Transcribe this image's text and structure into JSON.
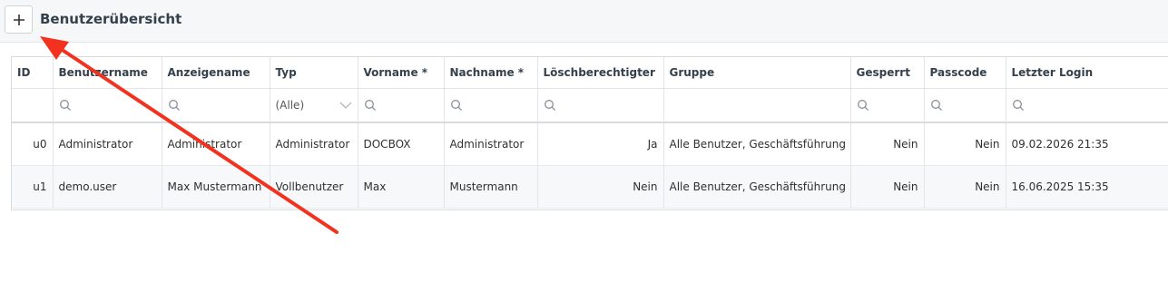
{
  "header": {
    "title": "Benutzerübersicht",
    "add_icon": "plus-icon"
  },
  "table": {
    "columns": [
      "ID",
      "Benutzername",
      "Anzeigename",
      "Typ",
      "Vorname *",
      "Nachname *",
      "Löschberechtigter",
      "Gruppe",
      "Gesperrt",
      "Passcode",
      "Letzter Login"
    ],
    "type_filter": {
      "selected": "(Alle)"
    },
    "rows": [
      {
        "id": "u0",
        "username": "Administrator",
        "display_name": "Administrator",
        "type": "Administrator",
        "first_name": "DOCBOX",
        "last_name": "Administrator",
        "deleter": "Ja",
        "group": "Alle Benutzer, Geschäftsführung",
        "locked": "Nein",
        "passcode": "Nein",
        "last_login": "09.02.2026 21:35"
      },
      {
        "id": "u1",
        "username": "demo.user",
        "display_name": "Max Mustermann",
        "type": "Vollbenutzer",
        "first_name": "Max",
        "last_name": "Mustermann",
        "deleter": "Nein",
        "group": "Alle Benutzer, Geschäftsführung",
        "locked": "Nein",
        "passcode": "Nein",
        "last_login": "16.06.2025 15:35"
      }
    ]
  },
  "annotation": {
    "arrow_color": "#f2321e"
  }
}
